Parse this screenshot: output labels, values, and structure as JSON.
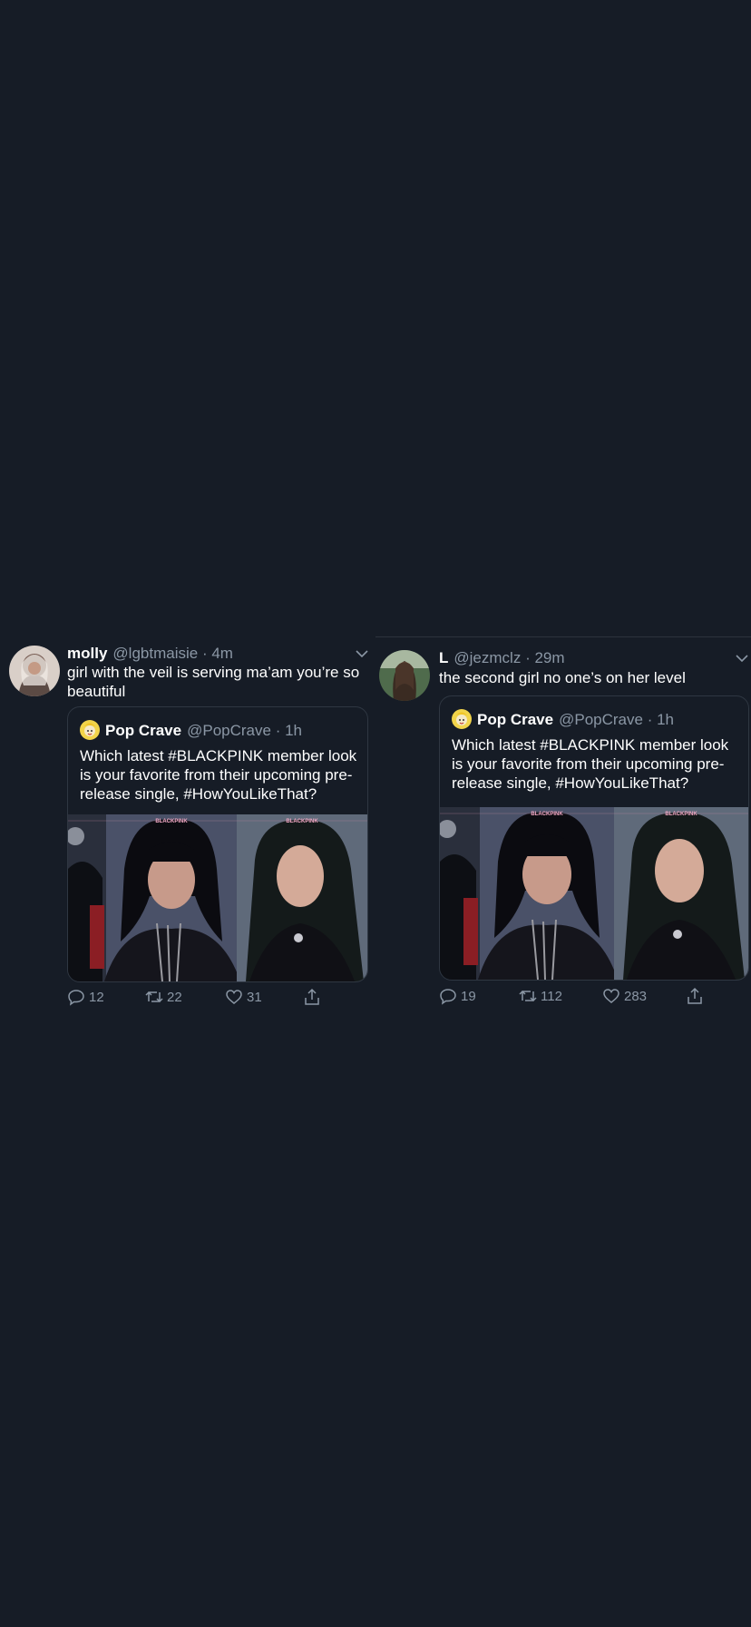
{
  "tweets": [
    {
      "name": "molly",
      "handle": "@lgbtmaisie",
      "time": "4m",
      "text": "girl with the veil is serving ma’am you’re so beautiful",
      "quote": {
        "name": "Pop Crave",
        "handle": "@PopCrave",
        "time": "1h",
        "text": "Which latest #BLACKPINK member look is your favorite from their upcoming pre-release single, #HowYouLikeThat?",
        "image_caption": "BLACKPINK"
      },
      "replies": "12",
      "retweets": "22",
      "likes": "31"
    },
    {
      "name": "L",
      "handle": "@jezmclz",
      "time": "29m",
      "text": "the second girl no one’s on her level",
      "quote": {
        "name": "Pop Crave",
        "handle": "@PopCrave",
        "time": "1h",
        "text": "Which latest #BLACKPINK member look is your favorite from their upcoming pre-release single, #HowYouLikeThat?",
        "image_caption": "BLACKPINK"
      },
      "replies": "19",
      "retweets": "112",
      "likes": "283"
    }
  ],
  "separator": "·",
  "colors": {
    "background": "#161c26",
    "text": "#ffffff",
    "muted": "#8b97a5",
    "border": "#2f3742"
  },
  "icons": [
    "chevron-down-icon",
    "reply-icon",
    "retweet-icon",
    "like-icon",
    "share-icon"
  ]
}
